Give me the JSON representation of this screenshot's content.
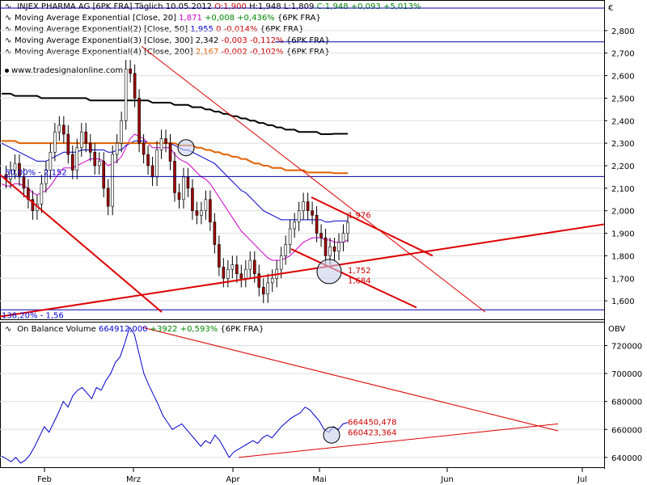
{
  "header": {
    "instrument": "INJEX PHARMA AG [6PK FRA]",
    "period": "Täglich",
    "date": "10.05.2012",
    "open": "O:1,900",
    "high": "H:1,948",
    "low": "L:1,809",
    "close": "C:1,948",
    "change": "+0,093",
    "change_pct": "+5,013%",
    "currency": "€"
  },
  "indicators": [
    {
      "name": "Moving Average Exponential [Close, 20]",
      "value": "1,871",
      "chg": "+0,008",
      "pct": "+0,436%",
      "src": "{6PK FRA}",
      "color": "#cc00cc",
      "chg_sign": "pos"
    },
    {
      "name": "Moving Average Exponential(2) [Close, 50]",
      "value": "1,955",
      "chg": "0",
      "pct": "-0,014%",
      "src": "{6PK FRA}",
      "color": "#0000cc",
      "chg_sign": "neg"
    },
    {
      "name": "Moving Average Exponential(3) [Close, 300]",
      "value": "2,342",
      "chg": "-0,003",
      "pct": "-0,112%",
      "src": "{6PK FRA}",
      "color": "#000000",
      "chg_sign": "neg"
    },
    {
      "name": "Moving Average Exponential(4) [Close, 200]",
      "value": "2,167",
      "chg": "-0,002",
      "pct": "-0,102%",
      "src": "{6PK FRA}",
      "color": "#e06000",
      "chg_sign": "neg"
    }
  ],
  "watermark": "www.tradesignalonline.com",
  "annotations": {
    "fib_top": "50,00% - 2,152",
    "fib_bottom": "138,20% - 1,56",
    "level_1976": "1,976",
    "level_1752": "1,752",
    "level_1684": "1,684",
    "obv_1": "664450,478",
    "obv_2": "660423,364"
  },
  "obv_header": {
    "name": "On Balance Volume",
    "value": "664912,000",
    "chg": "+3922",
    "pct": "+0,593%",
    "src": "{6PK FRA}",
    "axis_title": "OBV"
  },
  "chart_data": [
    {
      "type": "line",
      "title": "INJEX PHARMA AG [6PK FRA] Täglich",
      "xlabel": "",
      "ylabel": "€",
      "x_ticks": [
        "Feb",
        "Mrz",
        "Apr",
        "Mai",
        "Jun",
        "Jul"
      ],
      "y_ticks": [
        "2,800",
        "2,700",
        "2,600",
        "2,500",
        "2,400",
        "2,300",
        "2,200",
        "2,100",
        "2,000",
        "1,900",
        "1,800",
        "1,700",
        "1,600"
      ],
      "ylim": [
        1.5,
        2.9
      ],
      "grid": "horizontal",
      "x": [
        0,
        2,
        4,
        6,
        8,
        10,
        12,
        14,
        16,
        18,
        20,
        22,
        24,
        26,
        28,
        30,
        32,
        34,
        36,
        38,
        40,
        42,
        44,
        46,
        48,
        50,
        52,
        54,
        56,
        58,
        60,
        62,
        64,
        66,
        68,
        70,
        72,
        74,
        76,
        78,
        80,
        82,
        84,
        86,
        88,
        90,
        92,
        94,
        96,
        98,
        100,
        102,
        104,
        106,
        108,
        110,
        112,
        114,
        116,
        118,
        120,
        122,
        124,
        126,
        128,
        130,
        132,
        134,
        136,
        138,
        140,
        142,
        144,
        146,
        148,
        150,
        152,
        154,
        156
      ],
      "series": [
        {
          "name": "Close",
          "values": [
            2.16,
            2.14,
            2.18,
            2.21,
            2.15,
            2.1,
            2.05,
            2.0,
            2.03,
            2.12,
            2.18,
            2.26,
            2.35,
            2.38,
            2.34,
            2.25,
            2.18,
            2.28,
            2.35,
            2.3,
            2.26,
            2.2,
            2.22,
            2.1,
            2.02,
            2.25,
            2.3,
            2.4,
            2.63,
            2.61,
            2.5,
            2.3,
            2.25,
            2.2,
            2.15,
            2.27,
            2.32,
            2.3,
            2.22,
            2.08,
            2.05,
            2.15,
            2.1,
            2.0,
            1.98,
            2.0,
            2.05,
            1.95,
            1.85,
            1.75,
            1.7,
            1.74,
            1.76,
            1.72,
            1.7,
            1.74,
            1.78,
            1.72,
            1.66,
            1.63,
            1.68,
            1.7,
            1.74,
            1.8,
            1.85,
            1.92,
            1.95,
            2.0,
            2.04,
            2.0,
            1.98,
            1.9,
            1.88,
            1.8,
            1.84,
            1.82,
            1.86,
            1.9,
            1.948
          ]
        },
        {
          "name": "EMA 20",
          "values": [
            2.12,
            2.11,
            2.11,
            2.12,
            2.12,
            2.11,
            2.1,
            2.08,
            2.07,
            2.08,
            2.09,
            2.11,
            2.14,
            2.17,
            2.19,
            2.19,
            2.19,
            2.2,
            2.21,
            2.22,
            2.23,
            2.23,
            2.23,
            2.22,
            2.2,
            2.21,
            2.22,
            2.24,
            2.28,
            2.32,
            2.34,
            2.33,
            2.32,
            2.3,
            2.28,
            2.28,
            2.28,
            2.28,
            2.28,
            2.25,
            2.23,
            2.22,
            2.21,
            2.19,
            2.17,
            2.15,
            2.14,
            2.12,
            2.09,
            2.06,
            2.03,
            2.0,
            1.97,
            1.94,
            1.91,
            1.89,
            1.87,
            1.85,
            1.83,
            1.81,
            1.79,
            1.78,
            1.78,
            1.78,
            1.79,
            1.8,
            1.82,
            1.84,
            1.86,
            1.87,
            1.88,
            1.88,
            1.88,
            1.87,
            1.87,
            1.86,
            1.86,
            1.86,
            1.871
          ]
        },
        {
          "name": "EMA 50",
          "values": [
            2.3,
            2.29,
            2.28,
            2.27,
            2.26,
            2.25,
            2.24,
            2.23,
            2.22,
            2.22,
            2.22,
            2.23,
            2.24,
            2.25,
            2.26,
            2.26,
            2.26,
            2.26,
            2.27,
            2.27,
            2.27,
            2.27,
            2.27,
            2.27,
            2.26,
            2.26,
            2.27,
            2.27,
            2.29,
            2.3,
            2.31,
            2.31,
            2.31,
            2.3,
            2.3,
            2.3,
            2.3,
            2.3,
            2.3,
            2.29,
            2.28,
            2.27,
            2.27,
            2.26,
            2.25,
            2.24,
            2.23,
            2.22,
            2.21,
            2.19,
            2.17,
            2.15,
            2.13,
            2.11,
            2.09,
            2.08,
            2.06,
            2.04,
            2.02,
            2.0,
            1.99,
            1.98,
            1.97,
            1.96,
            1.96,
            1.96,
            1.96,
            1.96,
            1.96,
            1.96,
            1.96,
            1.96,
            1.96,
            1.95,
            1.95,
            1.955,
            1.955,
            1.955,
            1.955
          ]
        },
        {
          "name": "EMA 300",
          "values": [
            2.52,
            2.52,
            2.52,
            2.51,
            2.51,
            2.51,
            2.51,
            2.51,
            2.51,
            2.5,
            2.5,
            2.5,
            2.5,
            2.5,
            2.5,
            2.5,
            2.5,
            2.5,
            2.5,
            2.5,
            2.49,
            2.49,
            2.49,
            2.49,
            2.49,
            2.49,
            2.49,
            2.49,
            2.49,
            2.49,
            2.49,
            2.49,
            2.49,
            2.49,
            2.48,
            2.48,
            2.48,
            2.48,
            2.48,
            2.47,
            2.47,
            2.47,
            2.47,
            2.46,
            2.46,
            2.46,
            2.45,
            2.45,
            2.44,
            2.44,
            2.43,
            2.43,
            2.42,
            2.42,
            2.41,
            2.41,
            2.4,
            2.4,
            2.39,
            2.39,
            2.38,
            2.38,
            2.37,
            2.37,
            2.36,
            2.36,
            2.36,
            2.35,
            2.35,
            2.35,
            2.35,
            2.35,
            2.34,
            2.34,
            2.34,
            2.342,
            2.342,
            2.342,
            2.342
          ]
        },
        {
          "name": "EMA 200",
          "values": [
            2.31,
            2.31,
            2.31,
            2.31,
            2.3,
            2.3,
            2.3,
            2.3,
            2.3,
            2.3,
            2.3,
            2.3,
            2.3,
            2.3,
            2.3,
            2.3,
            2.3,
            2.3,
            2.3,
            2.3,
            2.3,
            2.3,
            2.3,
            2.3,
            2.3,
            2.3,
            2.3,
            2.3,
            2.3,
            2.3,
            2.3,
            2.3,
            2.3,
            2.3,
            2.3,
            2.3,
            2.3,
            2.3,
            2.3,
            2.3,
            2.29,
            2.29,
            2.29,
            2.29,
            2.28,
            2.28,
            2.27,
            2.27,
            2.26,
            2.26,
            2.25,
            2.25,
            2.24,
            2.24,
            2.23,
            2.23,
            2.22,
            2.21,
            2.21,
            2.2,
            2.2,
            2.19,
            2.19,
            2.19,
            2.18,
            2.18,
            2.18,
            2.18,
            2.18,
            2.17,
            2.17,
            2.17,
            2.17,
            2.17,
            2.17,
            2.167,
            2.167,
            2.167,
            2.167
          ]
        }
      ]
    },
    {
      "type": "line",
      "title": "On Balance Volume",
      "ylabel": "OBV",
      "x_ticks": [
        "Feb",
        "Mrz",
        "Apr",
        "Mai",
        "Jun",
        "Jul"
      ],
      "y_ticks": [
        "720000",
        "700000",
        "680000",
        "660000",
        "640000"
      ],
      "ylim": [
        633000,
        733000
      ],
      "grid": "horizontal",
      "series": [
        {
          "name": "On Balance Volume",
          "values": [
            641000,
            639000,
            637000,
            640000,
            636000,
            638000,
            642000,
            648000,
            655000,
            662000,
            658000,
            665000,
            672000,
            680000,
            676000,
            684000,
            688000,
            690000,
            686000,
            682000,
            690000,
            688000,
            695000,
            700000,
            708000,
            712000,
            722000,
            733000,
            728000,
            714000,
            700000,
            692000,
            685000,
            678000,
            670000,
            665000,
            660000,
            662000,
            664000,
            660000,
            656000,
            652000,
            648000,
            652000,
            650000,
            656000,
            652000,
            646000,
            640000,
            644000,
            646000,
            648000,
            650000,
            652000,
            650000,
            654000,
            656000,
            654000,
            658000,
            662000,
            665000,
            668000,
            670000,
            672000,
            676000,
            674000,
            670000,
            666000,
            660000,
            658000,
            662000,
            660000,
            664000,
            664912
          ]
        }
      ]
    }
  ]
}
